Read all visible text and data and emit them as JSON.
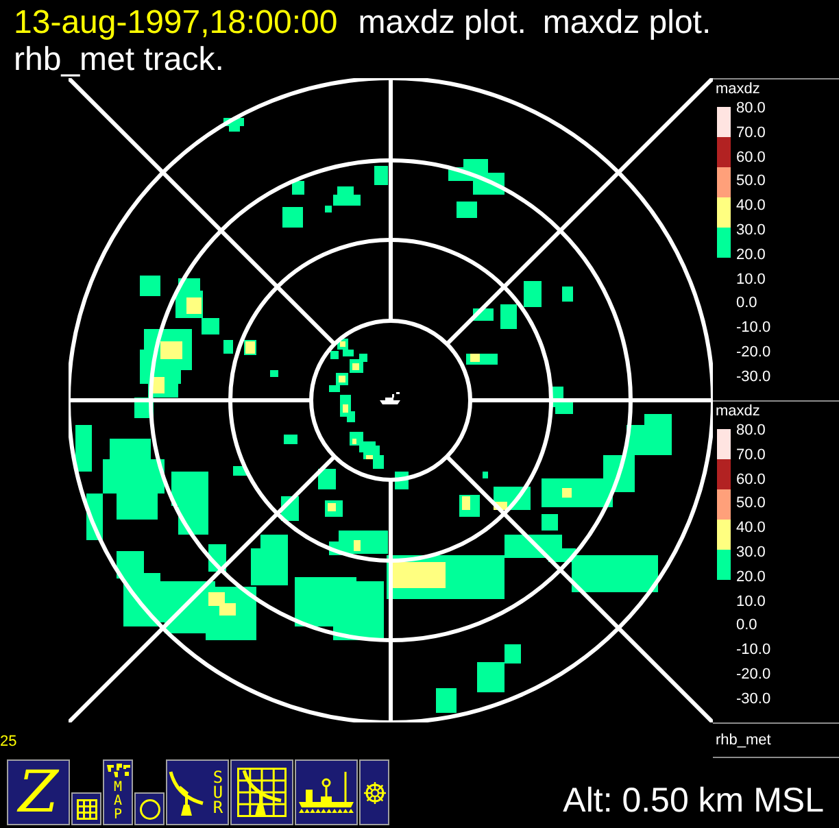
{
  "header": {
    "timestamp": "13-aug-1997,18:00:00",
    "plot_titles": [
      "maxdz plot.",
      "maxdz plot."
    ],
    "track": "rhb_met track."
  },
  "legends": [
    {
      "field": "maxdz",
      "bands": [
        {
          "color": "#ffe4e1"
        },
        {
          "color": "#b22222"
        },
        {
          "color": "#ffa07a"
        },
        {
          "color": "#ffff80"
        },
        {
          "color": "#00ff99"
        }
      ],
      "labels": [
        "80.0",
        "70.0",
        "60.0",
        "50.0",
        "40.0",
        "30.0",
        "20.0",
        "10.0",
        "0.0",
        "-10.0",
        "-20.0",
        "-30.0"
      ]
    },
    {
      "field": "maxdz",
      "bands": [
        {
          "color": "#ffe4e1"
        },
        {
          "color": "#b22222"
        },
        {
          "color": "#ffa07a"
        },
        {
          "color": "#ffff80"
        },
        {
          "color": "#00ff99"
        }
      ],
      "labels": [
        "80.0",
        "70.0",
        "60.0",
        "50.0",
        "40.0",
        "30.0",
        "20.0",
        "10.0",
        "0.0",
        "-10.0",
        "-20.0",
        "-30.0"
      ]
    }
  ],
  "track_label": "rhb_met",
  "toolbar": {
    "counter": "25",
    "buttons": [
      {
        "kind": "z",
        "label": "Z"
      },
      {
        "kind": "grid"
      },
      {
        "kind": "map",
        "label": "MAP"
      },
      {
        "kind": "circle"
      },
      {
        "kind": "radar",
        "label": "SUR"
      },
      {
        "kind": "radar-grid"
      },
      {
        "kind": "ship"
      },
      {
        "kind": "wheel"
      }
    ]
  },
  "altitude": "Alt: 0.50 km MSL"
}
